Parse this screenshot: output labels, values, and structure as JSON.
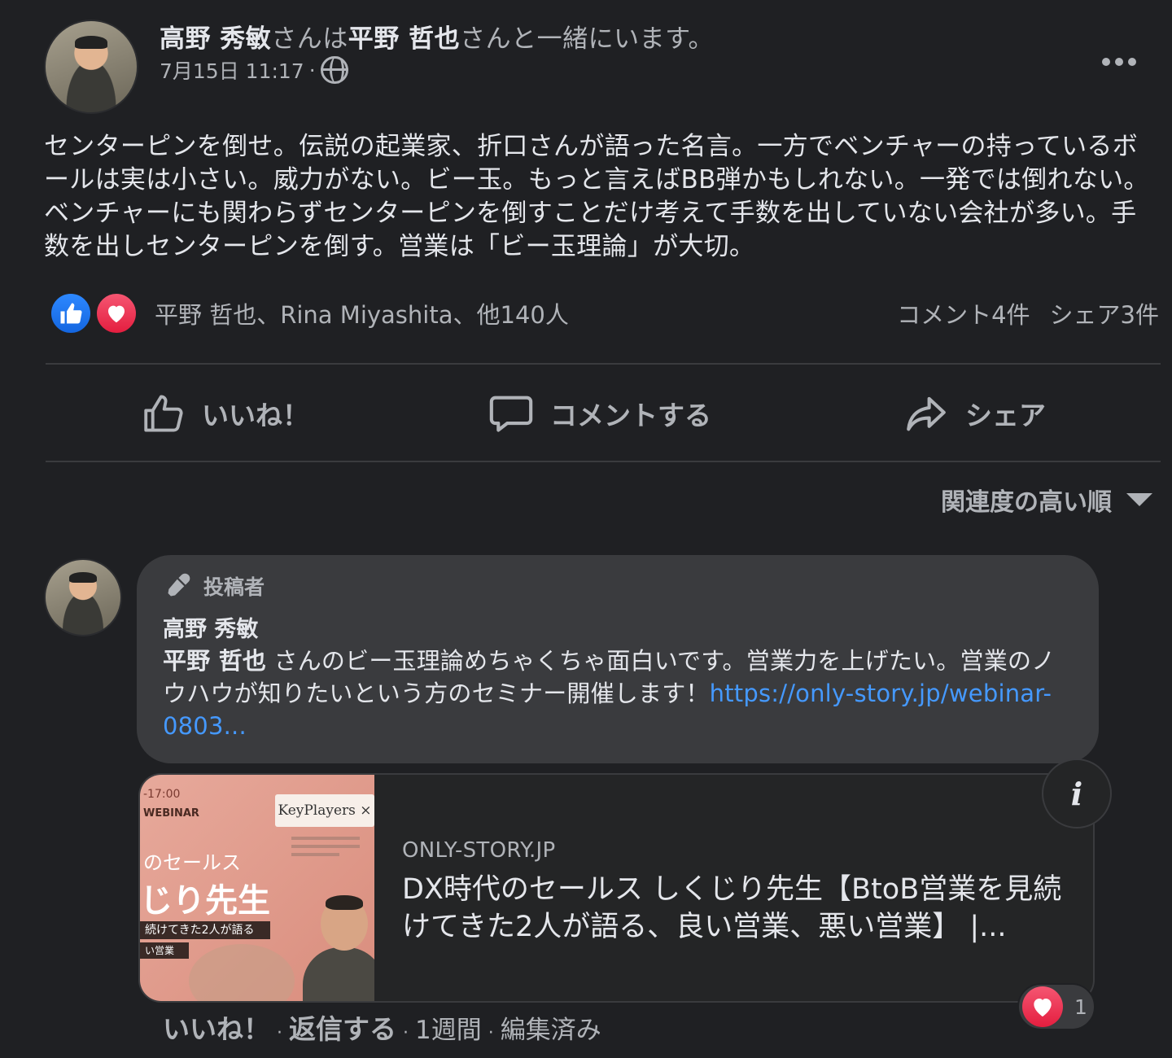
{
  "post": {
    "author": "高野 秀敏",
    "with_prefix": "さんは",
    "with_name": "平野 哲也",
    "with_suffix": "さんと一緒にいます。",
    "date": "7月15日 11:17",
    "meta_sep": "·",
    "privacy_icon": "globe-icon",
    "body": "センターピンを倒せ。伝説の起業家、折口さんが語った名言。一方でベンチャーの持っているボールは実は小さい。威力がない。ビー玉。もっと言えばBB弾かもしれない。一発では倒れない。ベンチャーにも関わらずセンターピンを倒すことだけ考えて手数を出していない会社が多い。手数を出しセンターピンを倒す。営業は「ビー玉理論」が大切。"
  },
  "reactions": {
    "names": "平野 哲也、Rina Miyashita、他140人",
    "comments": "コメント4件",
    "shares": "シェア3件",
    "like_color": "#2d88ff",
    "love_color": "#e41e3f"
  },
  "actions": {
    "like": "いいね！",
    "comment": "コメントする",
    "share": "シェア"
  },
  "sort": {
    "label": "関連度の高い順"
  },
  "comment": {
    "badge": "投稿者",
    "author": "高野 秀敏",
    "mention": "平野 哲也",
    "text": " さんのビー玉理論めちゃくちゃ面白いです。営業力を上げたい。営業のノウハウが知りたいという方のセミナー開催します！",
    "link": "https://only-story.jp/webinar-0803...",
    "link_color": "#4599ff",
    "card": {
      "thumb_time": "-17:00",
      "thumb_webinar": "WEBINAR",
      "thumb_logo": "KeyPlayers ×",
      "thumb_line1": "のセールス",
      "thumb_line2": "じり先生",
      "thumb_line3": "続けてきた2人が語る",
      "thumb_line4": "い営業",
      "site": "ONLY-STORY.JP",
      "title": "DX時代のセールス しくじり先生【BtoB営業を見続けてきた2人が語る、良い営業、悪い営業】 |..."
    },
    "actions": {
      "like": "いいね！",
      "reply": "返信する",
      "time": "1週間",
      "edited": "編集済み",
      "sep": "·"
    },
    "reaction_count": "1"
  }
}
